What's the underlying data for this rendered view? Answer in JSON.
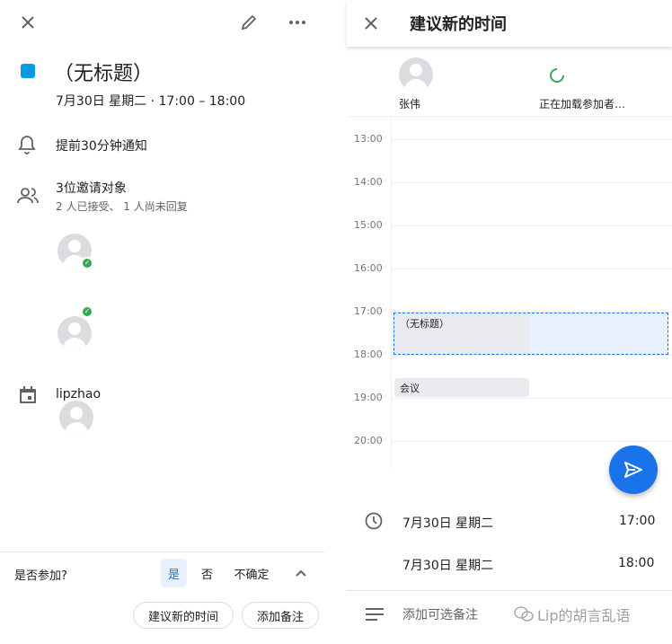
{
  "left": {
    "event_title": "（无标题）",
    "event_color": "#039be5",
    "event_time": "7月30日 星期二 · 17:00 – 18:00",
    "notification": "提前30分钟通知",
    "guests_title": "3位邀请对象",
    "guests_summary": "2 人已接受、 1 人尚未回复",
    "calendar_owner": "lipzhao",
    "rsvp": {
      "question": "是否参加?",
      "yes": "是",
      "no": "否",
      "maybe": "不确定"
    },
    "actions": {
      "propose": "建议新的时间",
      "add_note": "添加备注"
    }
  },
  "right": {
    "title": "建议新的时间",
    "attendee_name": "张伟",
    "loading_text": "正在加载参加者…",
    "hours": [
      "13:00",
      "14:00",
      "15:00",
      "16:00",
      "17:00",
      "18:00",
      "19:00",
      "20:00"
    ],
    "event_chip": "（无标题）",
    "meeting_chip": "会议",
    "start_date": "7月30日 星期二",
    "start_time": "17:00",
    "end_date": "7月30日 星期二",
    "end_time": "18:00",
    "note_placeholder": "添加可选备注",
    "watermark": "Lip的胡言乱语"
  },
  "colors": {
    "accent": "#1a73e8",
    "fab": "#1a73e8",
    "loading": "#34a853",
    "selection": "#e8f0fe"
  }
}
